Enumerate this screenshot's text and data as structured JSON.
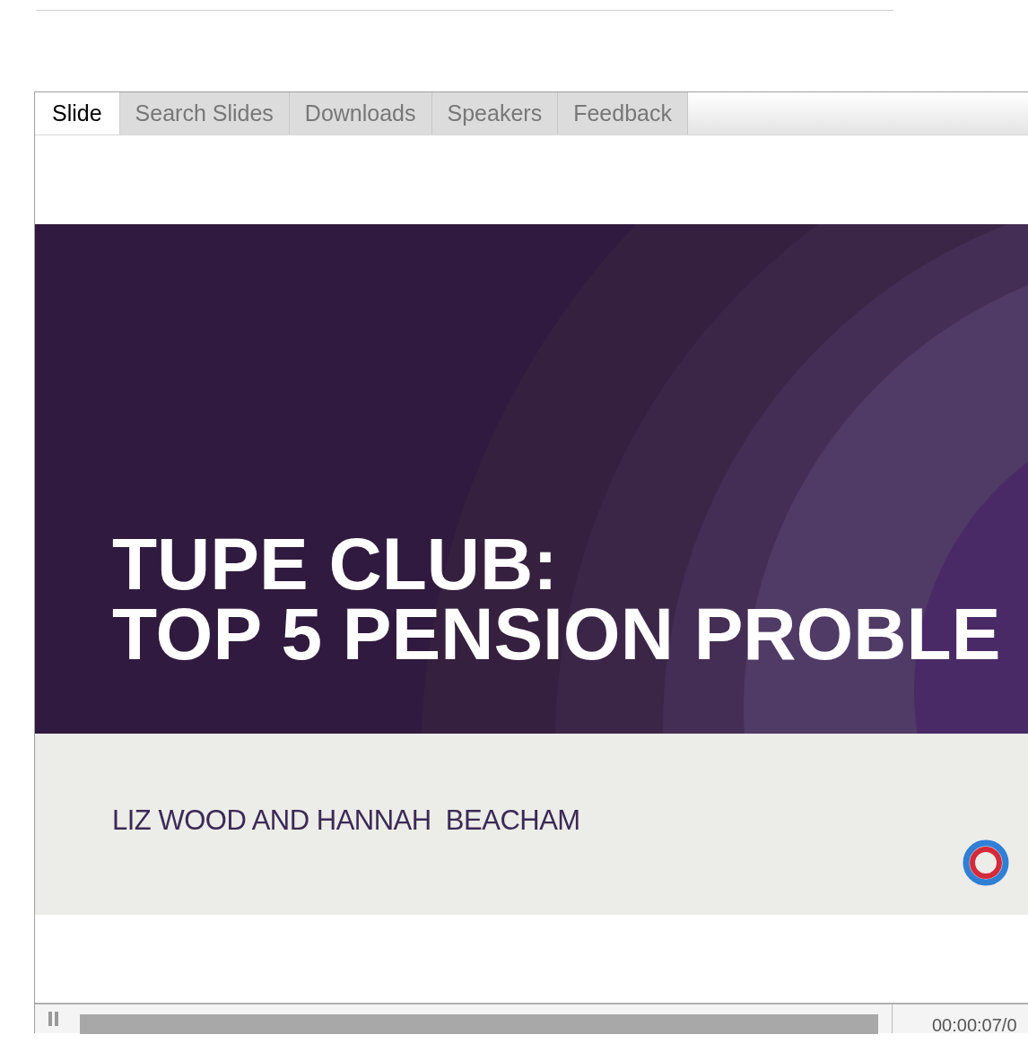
{
  "tabs": [
    {
      "label": "Slide",
      "selected": true
    },
    {
      "label": "Search Slides",
      "selected": false
    },
    {
      "label": "Downloads",
      "selected": false
    },
    {
      "label": "Speakers",
      "selected": false
    },
    {
      "label": "Feedback",
      "selected": false
    }
  ],
  "slide": {
    "title_lines": [
      "TUPE CLUB:",
      "TOP 5 PENSION PROBLE"
    ],
    "presenters": "LIZ WOOD AND HANNAH  BEACHAM"
  },
  "player": {
    "playing": true,
    "time": "00:00:07/0"
  }
}
